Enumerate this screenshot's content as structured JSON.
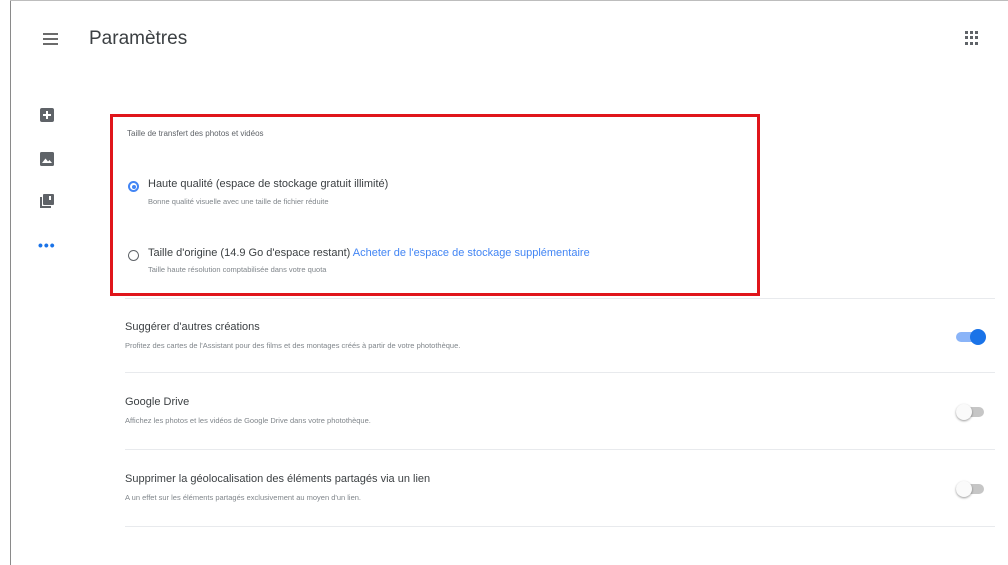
{
  "header": {
    "title": "Paramètres",
    "menu_icon": "menu-icon",
    "apps_icon": "apps-grid-icon",
    "edge_glyph": "("
  },
  "sidebar": {
    "items": [
      {
        "icon": "add-box-icon"
      },
      {
        "icon": "photo-icon"
      },
      {
        "icon": "albums-icon"
      },
      {
        "icon": "more-icon",
        "label": "•••"
      }
    ]
  },
  "upload": {
    "heading": "Taille de transfert des photos et vidéos",
    "options": [
      {
        "label": "Haute qualité (espace de stockage gratuit illimité)",
        "desc": "Bonne qualité visuelle avec une taille de fichier réduite",
        "selected": true
      },
      {
        "label": "Taille d'origine (14.9 Go d'espace restant)",
        "link": "Acheter de l'espace de stockage supplémentaire",
        "desc": "Taille haute résolution comptabilisée dans votre quota",
        "selected": false
      }
    ]
  },
  "settings": [
    {
      "title": "Suggérer d'autres créations",
      "desc": "Profitez des cartes de l'Assistant pour des films et des montages créés à partir de votre photothèque.",
      "enabled": true
    },
    {
      "title": "Google Drive",
      "desc": "Affichez les photos et les vidéos de Google Drive dans votre photothèque.",
      "enabled": false
    },
    {
      "title": "Supprimer la géolocalisation des éléments partagés via un lien",
      "desc": "A un effet sur les éléments partagés exclusivement au moyen d'un lien.",
      "enabled": false
    }
  ],
  "colors": {
    "accent": "#1a73e8",
    "highlight_border": "#e0151b"
  }
}
